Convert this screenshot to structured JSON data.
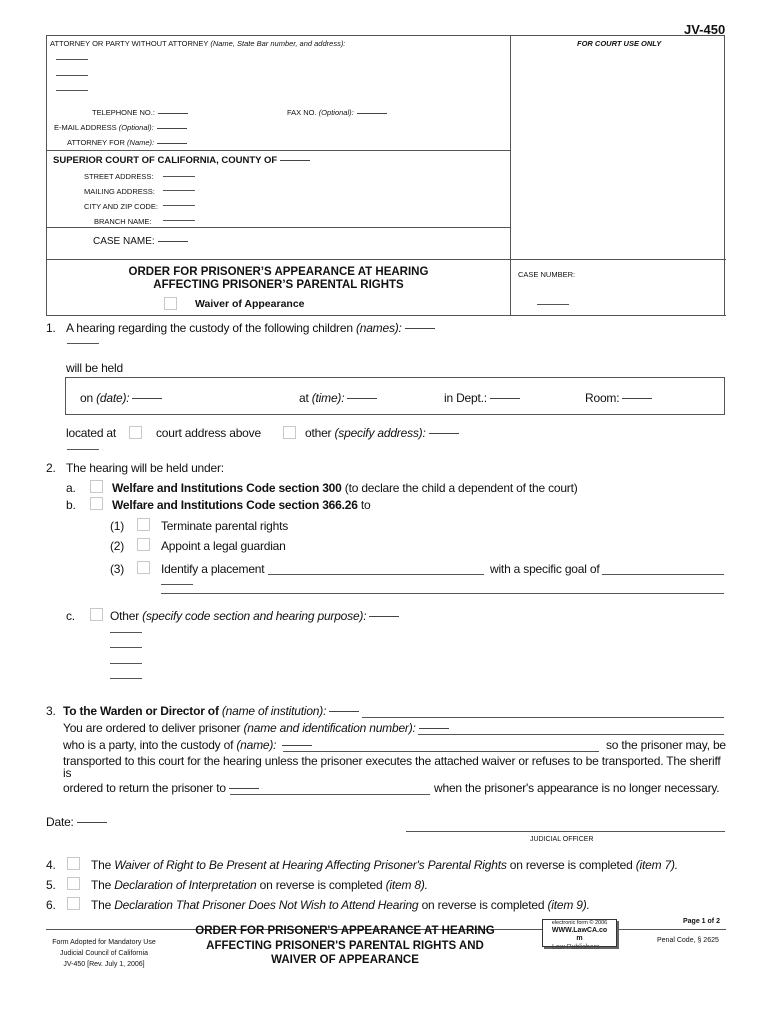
{
  "form_number": "JV-450",
  "attorney_block": {
    "label": "ATTORNEY OR PARTY WITHOUT ATTORNEY",
    "label_hint": "(Name, State Bar number, and address):",
    "telephone_label": "TELEPHONE NO.:",
    "fax_label": "FAX NO.",
    "fax_hint": "(Optional):",
    "email_label": "E-MAIL ADDRESS",
    "email_hint": "(Optional):",
    "attorney_for_label": "ATTORNEY FOR",
    "attorney_for_hint": "(Name):"
  },
  "court_use_label": "FOR COURT USE ONLY",
  "court_block": {
    "title": "SUPERIOR COURT OF CALIFORNIA, COUNTY OF",
    "street_label": "STREET ADDRESS:",
    "mailing_label": "MAILING ADDRESS:",
    "city_label": "CITY AND ZIP CODE:",
    "branch_label": "BRANCH NAME:"
  },
  "case_name_label": "CASE NAME:",
  "case_number_label": "CASE NUMBER:",
  "title": {
    "line1": "ORDER FOR PRISONER’S APPEARANCE AT HEARING",
    "line2": "AFFECTING PRISONER’S PARENTAL RIGHTS",
    "waiver_label": "Waiver of Appearance"
  },
  "item1": {
    "number": "1.",
    "text": "A hearing regarding the custody of the following children",
    "hint": "(names):",
    "will_be_held": "will be held",
    "on_label": "on",
    "on_hint": "(date):",
    "at_label": "at",
    "at_hint": "(time):",
    "dept_label": "in Dept.:",
    "room_label": "Room:",
    "located_at": "located at",
    "court_address_above": "court address above",
    "other_label": "other",
    "other_hint": "(specify address):"
  },
  "item2": {
    "number": "2.",
    "text": "The hearing will be held under:",
    "a_letter": "a.",
    "a_bold": "Welfare and Institutions Code section 300",
    "a_rest": "(to declare the child a dependent of the court)",
    "b_letter": "b.",
    "b_bold": "Welfare and Institutions Code section 366.26",
    "b_rest": "to",
    "sub": [
      {
        "num": "(1)",
        "label": "Terminate parental rights"
      },
      {
        "num": "(2)",
        "label": "Appoint a legal guardian"
      },
      {
        "num": "(3)",
        "label": "Identify a placement",
        "goal_label": "with a specific goal of"
      }
    ],
    "c_letter": "c.",
    "c_label": "Other",
    "c_hint": "(specify code section and hearing purpose):"
  },
  "item3": {
    "number": "3.",
    "warden_bold": "To the Warden or Director of",
    "warden_hint": "(name of institution):",
    "deliver_text": "You are ordered to deliver prisoner",
    "deliver_hint": "(name and identification number):",
    "custody_text": "who is a party, into the custody of",
    "custody_hint": "(name):",
    "so_text": "so the prisoner may, be",
    "transport_text": "transported to this court for the hearing unless the prisoner executes the attached waiver or refuses to be transported. The sheriff",
    "is_text": "is",
    "return_text": "ordered to return the prisoner to",
    "necessary_text": "when the prisoner's appearance is no longer necessary."
  },
  "date_label": "Date:",
  "judicial_officer_label": "JUDICIAL OFFICER",
  "items_4_6": [
    {
      "num": "4.",
      "pre": "The",
      "italic": "Waiver of Right to Be Present at Hearing Affecting Prisoner's Parental Rights",
      "post": "on reverse is completed",
      "ref": "(item 7)."
    },
    {
      "num": "5.",
      "pre": "The",
      "italic": "Declaration of Interpretation",
      "post": "on reverse is completed",
      "ref": "(item 8)."
    },
    {
      "num": "6.",
      "pre": "The",
      "italic": "Declaration That Prisoner Does Not Wish to Attend Hearing",
      "post": "on reverse is completed",
      "ref": "(item 9)."
    }
  ],
  "footer": {
    "adopted_line1": "Form Adopted for Mandatory Use",
    "adopted_line2": "Judicial Council of California",
    "adopted_line3": "JV-450 [Rev. July 1, 2006]",
    "title_line1": "ORDER FOR PRISONER'S APPEARANCE AT HEARING",
    "title_line2": "AFFECTING PRISONER'S PARENTAL RIGHTS AND",
    "title_line3": "WAIVER OF APPEARANCE",
    "stamp_line1": "electronic form © 2006",
    "stamp_line2": "WWW.LawCA.co",
    "stamp_line3": "m",
    "stamp_line4": "Law Publishers",
    "page_label": "Page 1 of 2",
    "penal_code": "Penal Code, § 2625"
  }
}
